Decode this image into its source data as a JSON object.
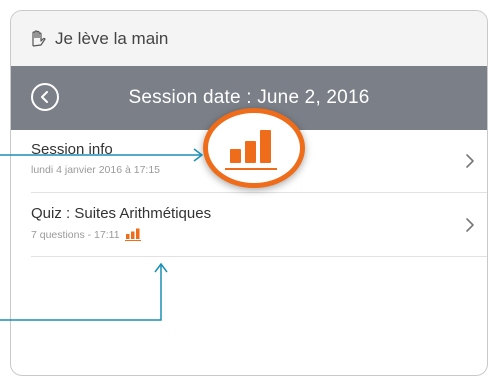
{
  "app": {
    "title": "Je lève la main",
    "icon": "raised-hand-icon"
  },
  "header": {
    "title": "Session date : June 2, 2016",
    "back_icon": "back-circle-icon"
  },
  "rows": [
    {
      "title": "Session info",
      "subtitle": "lundi 4 janvier 2016 à 17:15"
    },
    {
      "title": "Quiz : Suites Arithmétiques",
      "subtitle": "7 questions - 17:11",
      "status_icon": "bar-chart-icon"
    }
  ],
  "colors": {
    "accent": "#ef6c1a",
    "header_bg": "#7b7f88",
    "pointer": "#1a8fb5"
  }
}
